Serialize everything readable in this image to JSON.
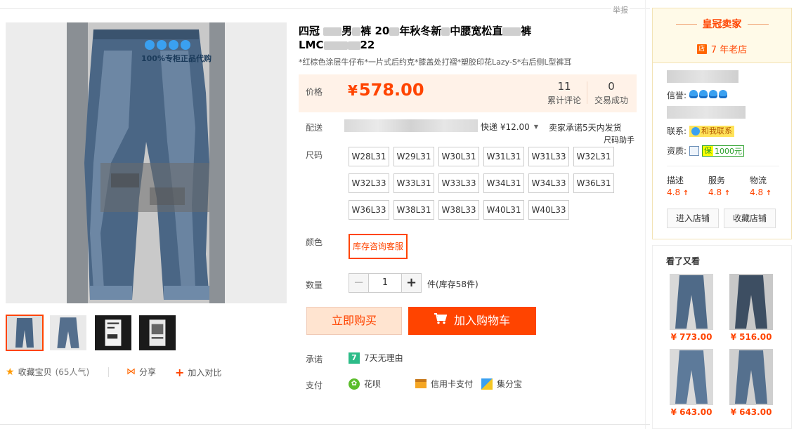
{
  "header": {
    "report": "举报"
  },
  "gallery": {
    "watermark": "100%专柜正品代购",
    "thumbs": [
      "thumb-1",
      "thumb-2",
      "thumb-3",
      "thumb-4"
    ],
    "favorite": "收藏宝贝",
    "favorite_count": "(65人气)",
    "share": "分享",
    "compare": "加入对比"
  },
  "product": {
    "title_1": "四冠",
    "title_2": "男",
    "title_3": "裤 20",
    "title_4": "年秋冬新",
    "title_5": "中腰宽松直",
    "title_6": "裤",
    "title_code_1": "LMC",
    "title_code_2": "22",
    "subtitle": "*红棕色涂层牛仔布*一片式后约克*膝盖处打褶*塑胶印花Lazy-S*右后侧L型裤耳",
    "price_label": "价格",
    "currency": "¥",
    "price": "578.00",
    "reviews_count": "11",
    "reviews_label": "累计评论",
    "sales_count": "0",
    "sales_label": "交易成功",
    "shipping_label": "配送",
    "shipping_method": "快递 ¥12.00",
    "shipping_promise": "卖家承诺5天内发货",
    "size_helper": "尺码助手",
    "size_label": "尺码",
    "sizes": [
      "W28L31",
      "W29L31",
      "W30L31",
      "W31L31",
      "W31L33",
      "W32L31",
      "W32L33",
      "W33L31",
      "W33L33",
      "W34L31",
      "W34L33",
      "W36L31",
      "W36L33",
      "W38L31",
      "W38L33",
      "W40L31",
      "W40L33"
    ],
    "color_label": "颜色",
    "color_option": "库存咨询客服",
    "qty_label": "数量",
    "qty_minus": "−",
    "qty_value": "1",
    "qty_plus": "+",
    "stock": "件(库存58件)",
    "buy_now": "立即购买",
    "add_to_cart": "加入购物车",
    "promise_label": "承诺",
    "promise_icon": "7",
    "promise_text": "7天无理由",
    "payment_label": "支付",
    "pay_1": "花呗",
    "pay_2": "信用卡支付",
    "pay_3": "集分宝"
  },
  "seller": {
    "crown": "皇冠卖家",
    "years_icon": "店",
    "years": "7 年老店",
    "credit_label": "信誉:",
    "contact_label": "联系:",
    "contact_btn": "和我联系",
    "qual_label": "资质:",
    "qual_amount": "1000元",
    "desc_label": "描述",
    "desc_score": "4.8",
    "service_label": "服务",
    "service_score": "4.8",
    "logistics_label": "物流",
    "logistics_score": "4.8",
    "up_arrow": "↑",
    "enter_shop": "进入店铺",
    "fav_shop": "收藏店铺"
  },
  "also_viewed": {
    "title": "看了又看",
    "items": [
      {
        "price": "¥ 773.00"
      },
      {
        "price": "¥ 516.00"
      },
      {
        "price": "¥ 643.00"
      },
      {
        "price": "¥ 643.00"
      }
    ]
  },
  "colors": {
    "accent": "#ff4400",
    "price": "#ff4400",
    "price_bg": "#fff2e8"
  }
}
